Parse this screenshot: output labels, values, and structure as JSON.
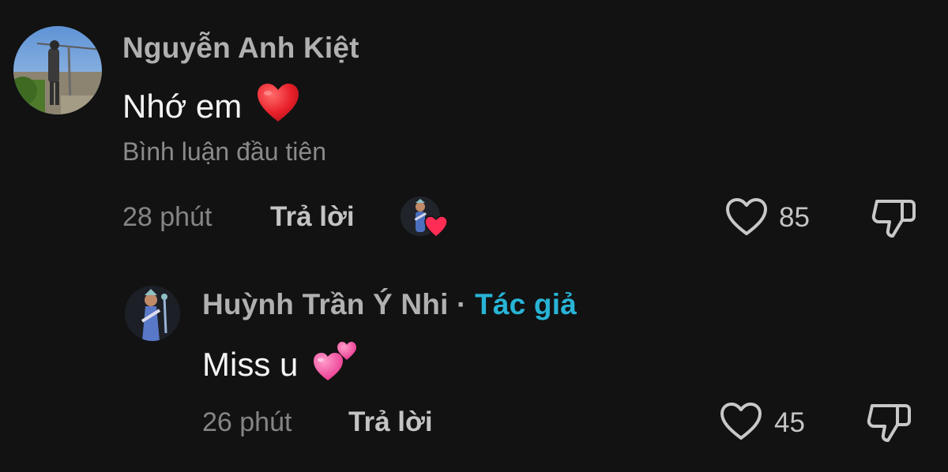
{
  "comments": [
    {
      "username": "Nguyễn Anh Kiệt",
      "text": "Nhớ em",
      "emoji": "heart-emoji",
      "pinned_label": "Bình luận đầu tiên",
      "time": "28 phút",
      "reply_label": "Trả lời",
      "likes": "85",
      "liked_by_creator": true
    },
    {
      "username": "Huỳnh Trần Ý Nhi",
      "separator": "·",
      "author_label": "Tác giả",
      "text": "Miss u",
      "emoji": "two-hearts-emoji",
      "time": "26 phút",
      "reply_label": "Trả lời",
      "likes": "45"
    }
  ],
  "icons": {
    "like": "heart-outline-icon",
    "dislike": "thumbs-down-icon"
  },
  "colors": {
    "background": "#121212",
    "author_tag": "#28b4d6",
    "heart_red": "#e8202a",
    "heart_pink": "#ff4f9a"
  }
}
